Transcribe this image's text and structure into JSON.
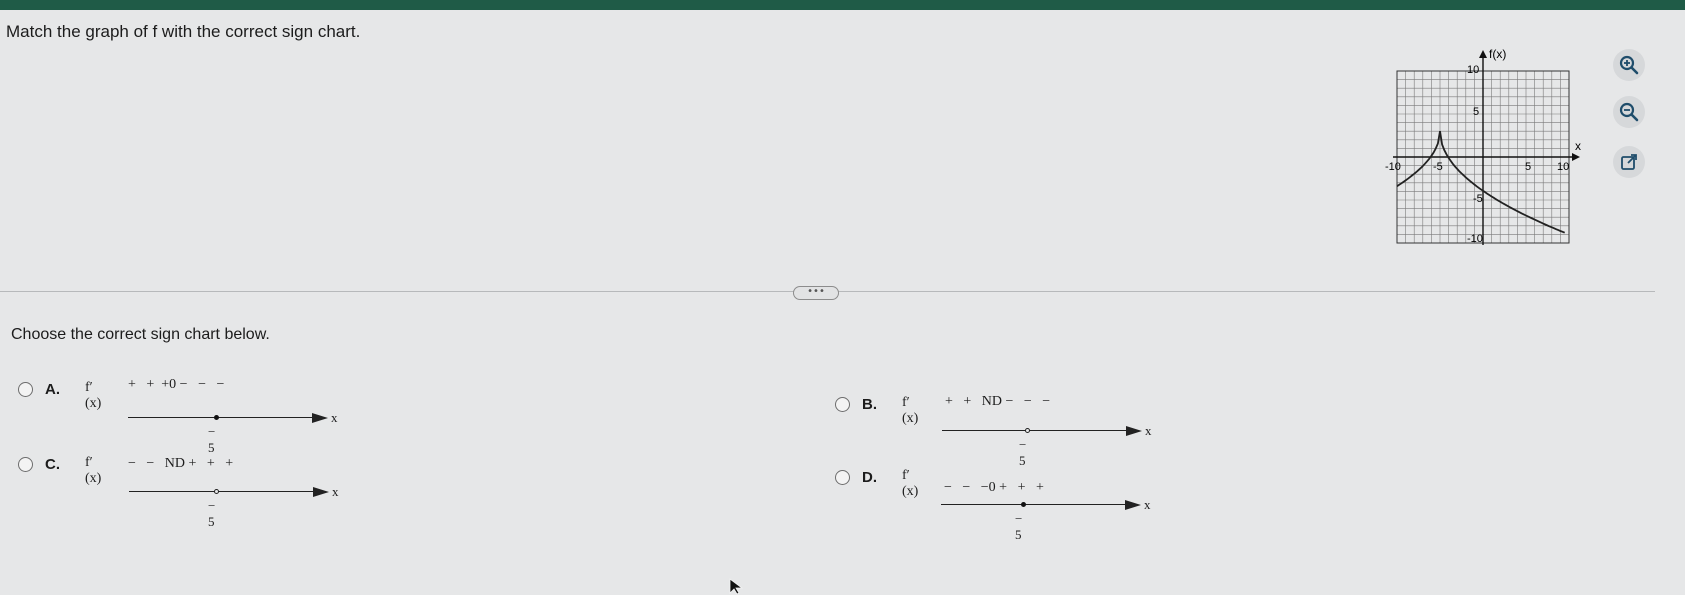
{
  "question": {
    "text": "Match the graph of f with the correct sign chart."
  },
  "graph": {
    "y_axis_label": "f(x)",
    "x_axis_label": "x",
    "tick_labels": {
      "x_neg10": "-10",
      "x_neg5": "-5",
      "x_5": "5",
      "x_10": "10",
      "y_10": "10",
      "y_5": "5",
      "y_neg5": "-5",
      "y_neg10": "-10"
    },
    "x_range": [
      -10,
      10
    ],
    "y_range": [
      -10,
      10
    ],
    "grid": true,
    "curve_color": "#222222"
  },
  "tools": {
    "zoom_in_icon": "zoom-in-icon",
    "zoom_out_icon": "zoom-out-icon",
    "popout_icon": "external-link-icon"
  },
  "more_button": {
    "label": "•••"
  },
  "prompt": {
    "text": "Choose the correct sign chart below."
  },
  "options": [
    {
      "letter": "A.",
      "func": "f′(x)",
      "signs": "+   +  +0 −   −   −",
      "point_label": "− 5",
      "point_type": "closed",
      "axis_var": "x"
    },
    {
      "letter": "B.",
      "func": "f′(x)",
      "signs": "+   +   ND −   −   −",
      "point_label": "− 5",
      "point_type": "open",
      "axis_var": "x"
    },
    {
      "letter": "C.",
      "func": "f′(x)",
      "signs": "−   −   ND +   +   +",
      "point_label": "− 5",
      "point_type": "open",
      "axis_var": "x"
    },
    {
      "letter": "D.",
      "func": "f′(x)",
      "signs": "−   −   −0 +   +   +",
      "point_label": "− 5",
      "point_type": "closed",
      "axis_var": "x"
    }
  ]
}
